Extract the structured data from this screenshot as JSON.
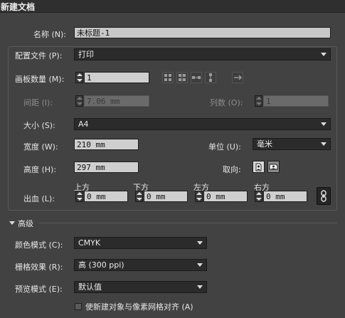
{
  "window": {
    "title": "新建文档"
  },
  "name": {
    "label": "名称 (N):",
    "value": "未标题-1"
  },
  "profile": {
    "label": "配置文件 (P):",
    "value": "打印"
  },
  "artboards": {
    "label": "画板数量 (M):",
    "value": "1"
  },
  "spacing": {
    "label": "间距 (I):",
    "value": "7.06 mm"
  },
  "columns": {
    "label": "列数 (O):",
    "value": "1"
  },
  "size": {
    "label": "大小 (S):",
    "value": "A4"
  },
  "width": {
    "label": "宽度 (W):",
    "value": "210 mm"
  },
  "units": {
    "label": "单位 (U):",
    "value": "毫米"
  },
  "height": {
    "label": "高度 (H):",
    "value": "297 mm"
  },
  "orientation": {
    "label": "取向:"
  },
  "bleed": {
    "label": "出血 (L):",
    "top_label": "上方",
    "bottom_label": "下方",
    "left_label": "左方",
    "right_label": "右方",
    "top": "0 mm",
    "bottom": "0 mm",
    "left": "0 mm",
    "right": "0 mm"
  },
  "advanced": {
    "label": "高级"
  },
  "color_mode": {
    "label": "颜色模式 (C):",
    "value": "CMYK"
  },
  "raster": {
    "label": "栅格效果 (R):",
    "value": "高 (300 ppi)"
  },
  "preview": {
    "label": "预览模式 (E):",
    "value": "默认值"
  },
  "align_pixel": {
    "label": "使新建对象与像素网格对齐 (A)"
  },
  "icons": {
    "grid_by_row": "grid-by-row-icon",
    "grid_by_column": "grid-by-column-icon",
    "arrange_by_row": "arrange-by-row-icon",
    "arrange_by_column": "arrange-by-column-icon",
    "right_to_left": "right-to-left-icon",
    "portrait": "portrait-icon",
    "landscape": "landscape-icon",
    "link": "link-icon"
  }
}
